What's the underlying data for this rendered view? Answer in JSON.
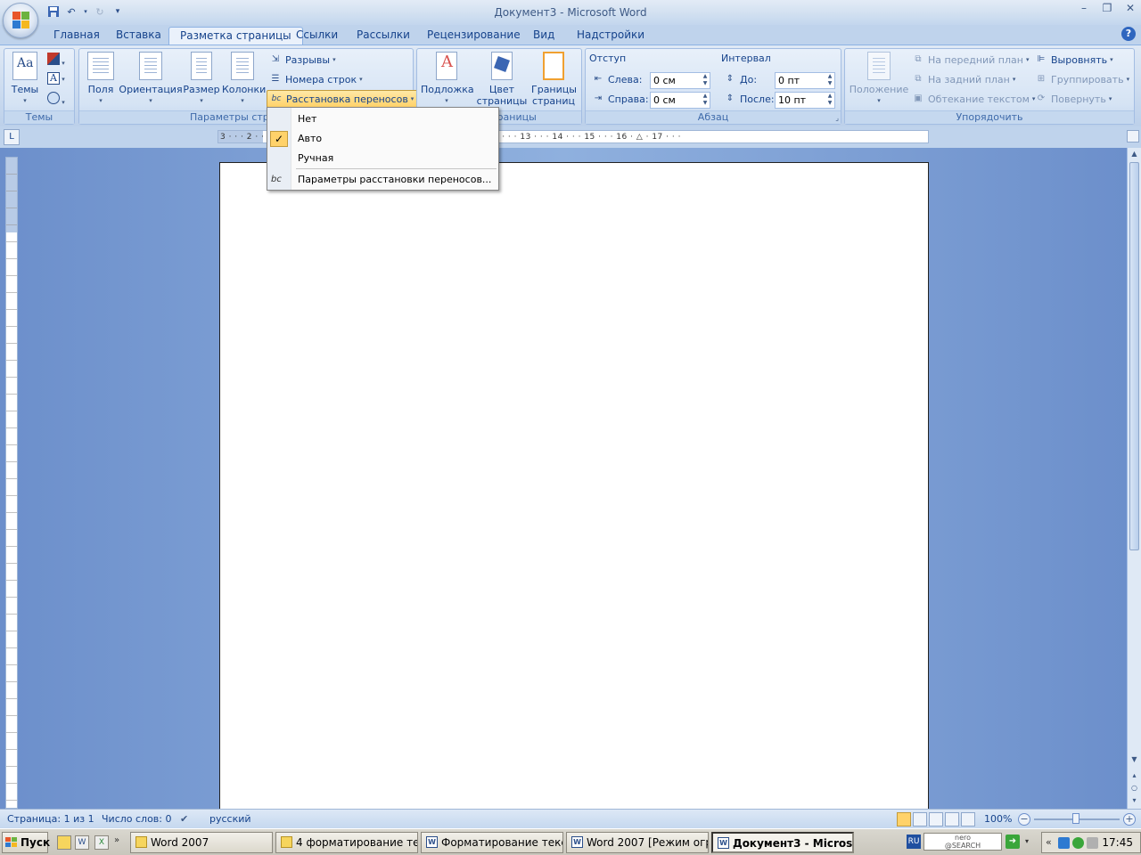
{
  "window": {
    "title": "Документ3 - Microsoft Word",
    "controls": [
      "–",
      "❐",
      "✕"
    ]
  },
  "tabs": [
    "Главная",
    "Вставка",
    "Разметка страницы",
    "Ссылки",
    "Рассылки",
    "Рецензирование",
    "Вид",
    "Надстройки"
  ],
  "active_tab": "Разметка страницы",
  "ribbon": {
    "themes": {
      "label": "Темы",
      "group": "Темы"
    },
    "page_setup": {
      "fields": "Поля",
      "orientation": "Ориентация",
      "size": "Размер",
      "columns": "Колонки",
      "breaks": "Разрывы",
      "line_numbers": "Номера строк",
      "hyphenation": "Расстановка переносов",
      "group": "Параметры страницы"
    },
    "page_background": {
      "watermark": "Подложка",
      "page_color_1": "Цвет",
      "page_color_2": "страницы",
      "borders_1": "Границы",
      "borders_2": "страниц",
      "group": "Фон страницы"
    },
    "paragraph": {
      "indent_title": "Отступ",
      "left_label": "Слева:",
      "left_value": "0 см",
      "right_label": "Справа:",
      "right_value": "0 см",
      "spacing_title": "Интервал",
      "before_label": "До:",
      "before_value": "0 пт",
      "after_label": "После:",
      "after_value": "10 пт",
      "group": "Абзац"
    },
    "arrange": {
      "position": "Положение",
      "bring_front": "На передний план",
      "send_back": "На задний план",
      "text_wrap": "Обтекание текстом",
      "align": "Выровнять",
      "group_btn": "Группировать",
      "rotate": "Повернуть",
      "group": "Упорядочить"
    }
  },
  "hyphenation_menu": {
    "items": [
      "Нет",
      "Авто",
      "Ручная"
    ],
    "checked": "Авто",
    "options": "Параметры расстановки переносов..."
  },
  "ruler": {
    "text": "3 · · · 2 · · · 1 · · ·                                          · · · 6 · · · 7 · · · 8 · · · 9 · · · 10 · · · 11 · · · 12 · · · 13 · · · 14 · · · 15 · · · 16 · △ · 17 · · · "
  },
  "status": {
    "page": "Страница: 1 из 1",
    "words": "Число слов: 0",
    "language": "русский",
    "zoom": "100%"
  },
  "taskbar": {
    "start": "Пуск",
    "tasks": [
      "Word 2007",
      "4 форматирование тек...",
      "Форматирование текст...",
      "Word 2007 [Режим огра...",
      "Документ3 - Microso..."
    ],
    "lang": "RU",
    "nero": "nero\n@SEARCH",
    "clock": "17:45"
  }
}
